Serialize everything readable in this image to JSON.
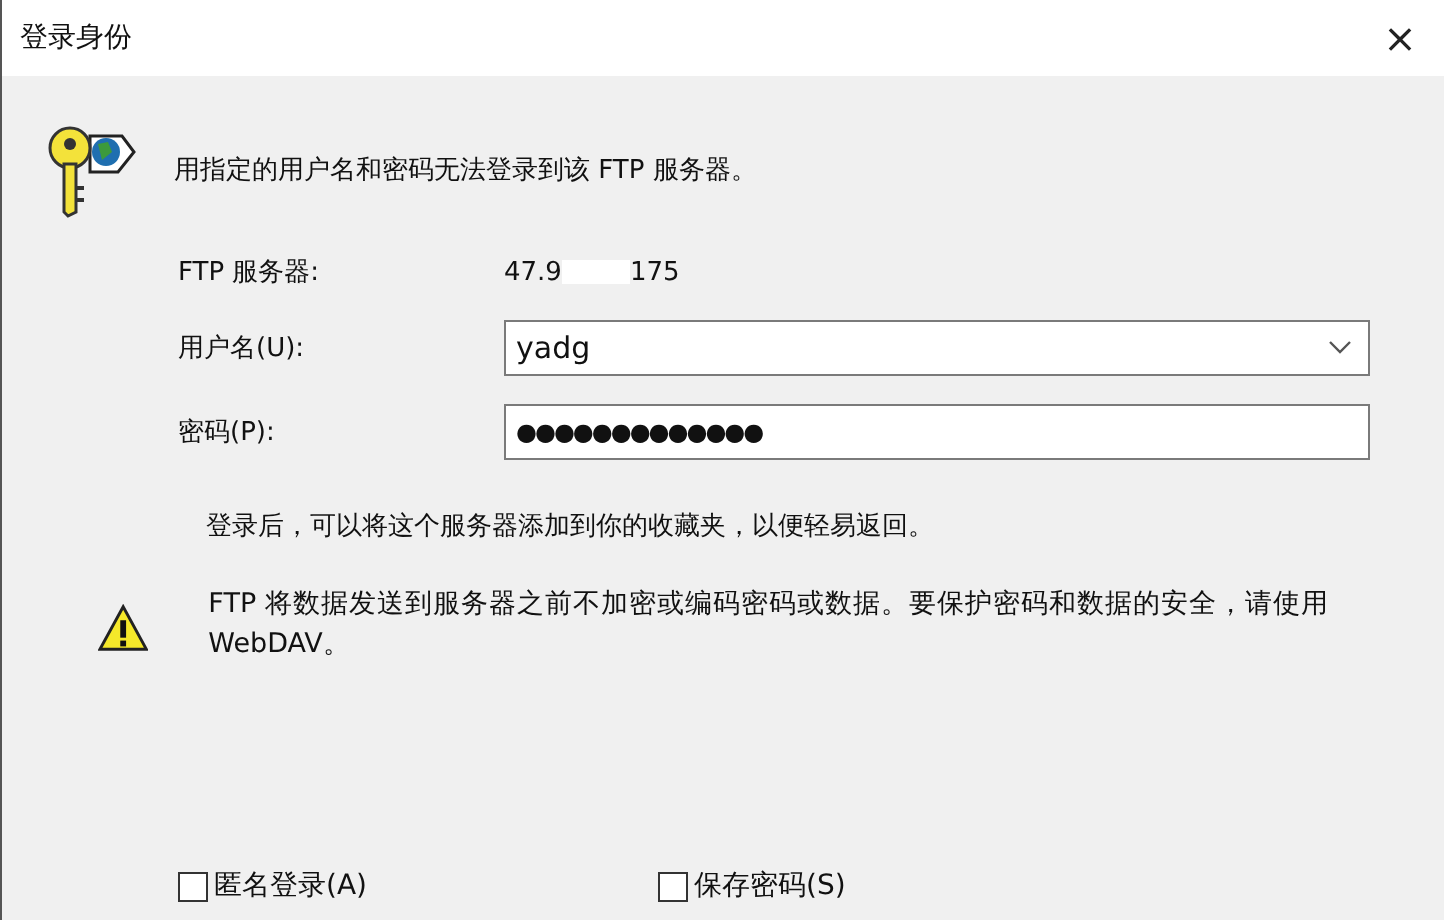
{
  "window": {
    "title": "登录身份",
    "close": "×"
  },
  "message": "用指定的用户名和密码无法登录到该 FTP 服务器。",
  "server": {
    "label": "FTP 服务器:",
    "value_start": "47.9",
    "value_end": "175"
  },
  "username": {
    "label": "用户名(U):",
    "value": "yadg"
  },
  "password": {
    "label": "密码(P):",
    "value": "●●●●●●●●●●●●●"
  },
  "note": "登录后，可以将这个服务器添加到你的收藏夹，以便轻易返回。",
  "warning": "FTP 将数据发送到服务器之前不加密或编码密码或数据。要保护密码和数据的安全，请使用 WebDAV。",
  "options": [
    {
      "label": "匿名登录(A)",
      "checked": false
    },
    {
      "label": "保存密码(S)",
      "checked": false
    }
  ]
}
